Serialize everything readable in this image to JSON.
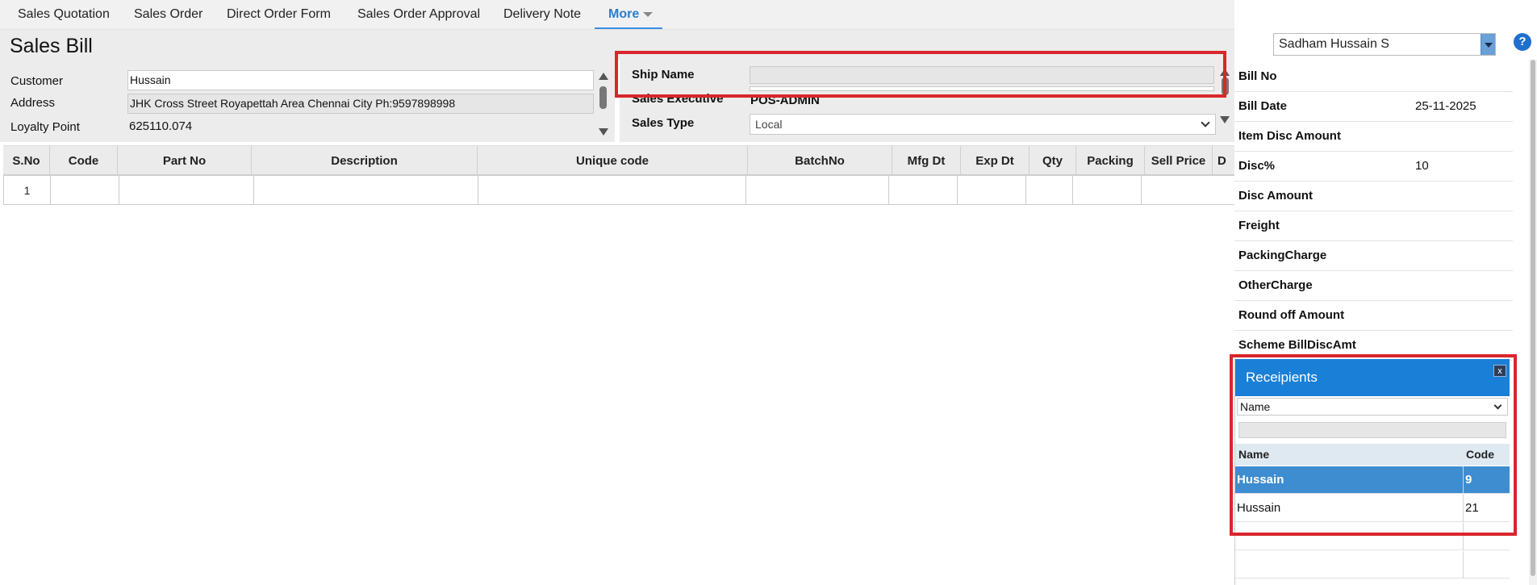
{
  "nav": {
    "tabs": [
      "Sales Quotation",
      "Sales Order",
      "Direct Order Form",
      "Sales Order Approval",
      "Delivery Note"
    ],
    "more_label": "More"
  },
  "page": {
    "title": "Sales Bill"
  },
  "customer": {
    "customer_label": "Customer",
    "customer_value": "Hussain",
    "address_label": "Address",
    "address_value": "JHK Cross Street Royapettah Area Chennai City Ph:9597898998",
    "loyalty_label": "Loyalty Point",
    "loyalty_value": "625110.074"
  },
  "shipping": {
    "ship_name_label": "Ship Name",
    "ship_name_value": "",
    "sales_exec_label": "Sales Executive",
    "sales_exec_value": "POS-ADMIN",
    "sales_type_label": "Sales Type",
    "sales_type_value": "Local"
  },
  "grid": {
    "columns": [
      "S.No",
      "Code",
      "Part No",
      "Description",
      "Unique code",
      "BatchNo",
      "Mfg Dt",
      "Exp Dt",
      "Qty",
      "Packing",
      "Sell Price",
      "D"
    ],
    "rows": [
      [
        "1",
        "",
        "",
        "",
        "",
        "",
        "",
        "",
        "",
        "",
        "",
        ""
      ]
    ]
  },
  "user": {
    "selected": "Sadham Hussain S"
  },
  "summary": [
    {
      "label": "Bill No",
      "value": ""
    },
    {
      "label": "Bill Date",
      "value": "25-11-2025"
    },
    {
      "label": "Item Disc Amount",
      "value": ""
    },
    {
      "label": "Disc%",
      "value": "10"
    },
    {
      "label": "Disc Amount",
      "value": ""
    },
    {
      "label": "Freight",
      "value": ""
    },
    {
      "label": "PackingCharge",
      "value": ""
    },
    {
      "label": "OtherCharge",
      "value": ""
    },
    {
      "label": "Round off Amount",
      "value": ""
    },
    {
      "label": "Scheme BillDiscAmt",
      "value": ""
    }
  ],
  "recipients": {
    "title": "Receipients",
    "close_label": "x",
    "filter_value": "Name",
    "search_value": "",
    "col_name": "Name",
    "col_code": "Code",
    "rows": [
      {
        "name": "Hussain",
        "code": "9",
        "selected": true
      },
      {
        "name": "Hussain",
        "code": "21",
        "selected": false
      }
    ]
  },
  "colors": {
    "accent": "#1a7fd6",
    "highlight": "#d9262c",
    "selected_row": "#3d8dd0"
  }
}
